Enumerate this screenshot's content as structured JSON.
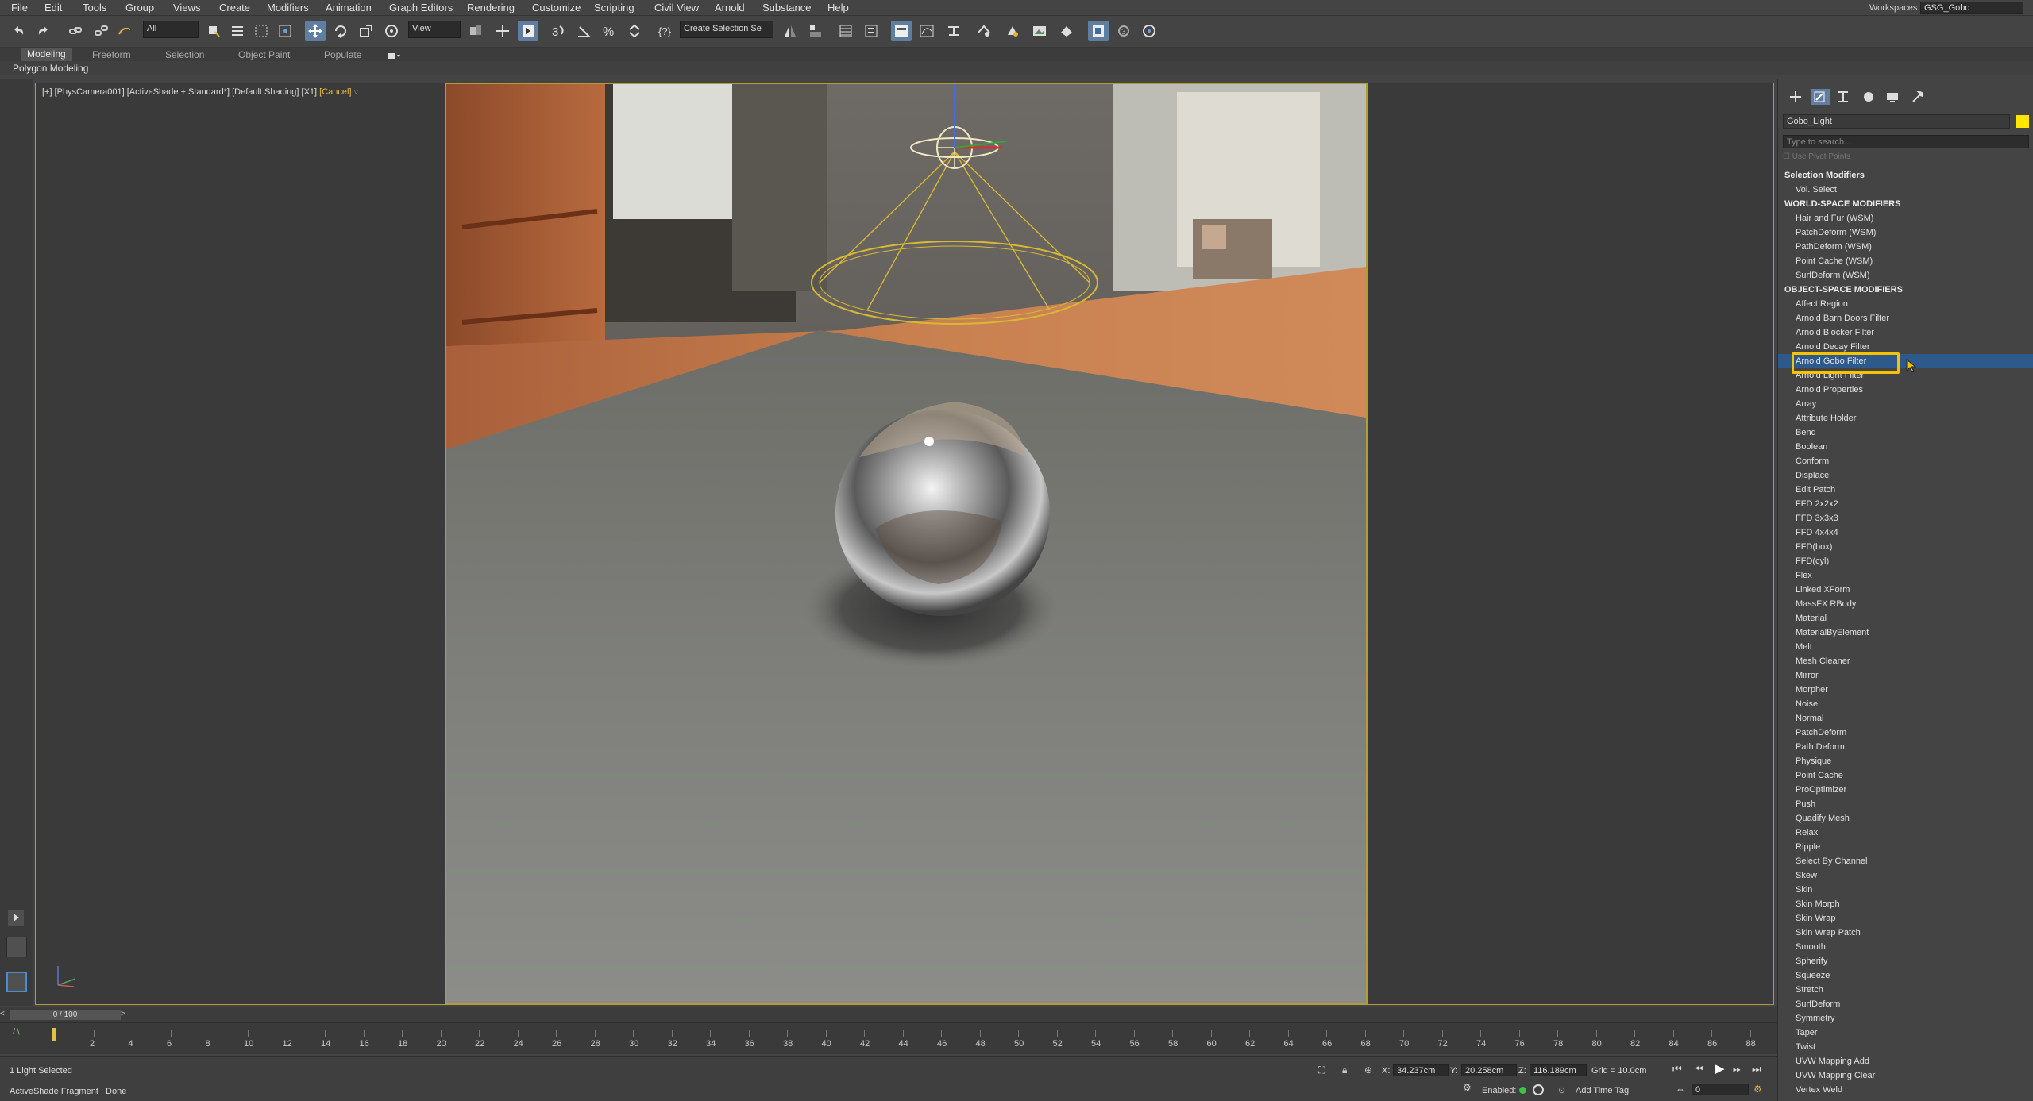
{
  "menu": [
    "File",
    "Edit",
    "Tools",
    "Group",
    "Views",
    "Create",
    "Modifiers",
    "Animation",
    "Graph Editors",
    "Rendering",
    "Customize",
    "Scripting",
    "Civil View",
    "Arnold",
    "Substance",
    "Help"
  ],
  "workspace": {
    "label": "Workspaces:",
    "value": "GSG_Gobo"
  },
  "toolbar": {
    "filter_value": "All",
    "ref_coord_value": "View",
    "selection_set_placeholder": "Create Selection Se"
  },
  "ribbon": {
    "tabs": [
      "Modeling",
      "Freeform",
      "Selection",
      "Object Paint",
      "Populate"
    ],
    "active_tab": "Modeling",
    "sub_label": "Polygon Modeling"
  },
  "viewport": {
    "label_main": "[+] [PhysCamera001] [ActiveShade + Standard*] [Default Shading] [X1]",
    "label_cancel": "[Cancel]"
  },
  "command_panel": {
    "object_name": "Gobo_Light",
    "object_color": "#ffe600",
    "search_placeholder": "Type to search...",
    "use_pivot_points": "Use Pivot Points",
    "modifier_list": [
      {
        "type": "header",
        "label": "Selection Modifiers"
      },
      {
        "type": "item",
        "label": "Vol. Select"
      },
      {
        "type": "header",
        "label": "WORLD-SPACE MODIFIERS"
      },
      {
        "type": "item",
        "label": "Hair and Fur (WSM)"
      },
      {
        "type": "item",
        "label": "PatchDeform (WSM)"
      },
      {
        "type": "item",
        "label": "PathDeform (WSM)"
      },
      {
        "type": "item",
        "label": "Point Cache (WSM)"
      },
      {
        "type": "item",
        "label": "SurfDeform (WSM)"
      },
      {
        "type": "header",
        "label": "OBJECT-SPACE MODIFIERS"
      },
      {
        "type": "item",
        "label": "Affect Region"
      },
      {
        "type": "item",
        "label": "Arnold Barn Doors Filter"
      },
      {
        "type": "item",
        "label": "Arnold Blocker Filter"
      },
      {
        "type": "item",
        "label": "Arnold Decay Filter"
      },
      {
        "type": "item",
        "label": "Arnold Gobo Filter",
        "selected": true
      },
      {
        "type": "item",
        "label": "Arnold Light Filter"
      },
      {
        "type": "item",
        "label": "Arnold Properties"
      },
      {
        "type": "item",
        "label": "Array"
      },
      {
        "type": "item",
        "label": "Attribute Holder"
      },
      {
        "type": "item",
        "label": "Bend"
      },
      {
        "type": "item",
        "label": "Boolean"
      },
      {
        "type": "item",
        "label": "Conform"
      },
      {
        "type": "item",
        "label": "Displace"
      },
      {
        "type": "item",
        "label": "Edit Patch"
      },
      {
        "type": "item",
        "label": "FFD 2x2x2"
      },
      {
        "type": "item",
        "label": "FFD 3x3x3"
      },
      {
        "type": "item",
        "label": "FFD 4x4x4"
      },
      {
        "type": "item",
        "label": "FFD(box)"
      },
      {
        "type": "item",
        "label": "FFD(cyl)"
      },
      {
        "type": "item",
        "label": "Flex"
      },
      {
        "type": "item",
        "label": "Linked XForm"
      },
      {
        "type": "item",
        "label": "MassFX RBody"
      },
      {
        "type": "item",
        "label": "Material"
      },
      {
        "type": "item",
        "label": "MaterialByElement"
      },
      {
        "type": "item",
        "label": "Melt"
      },
      {
        "type": "item",
        "label": "Mesh Cleaner"
      },
      {
        "type": "item",
        "label": "Mirror"
      },
      {
        "type": "item",
        "label": "Morpher"
      },
      {
        "type": "item",
        "label": "Noise"
      },
      {
        "type": "item",
        "label": "Normal"
      },
      {
        "type": "item",
        "label": "PatchDeform"
      },
      {
        "type": "item",
        "label": "Path Deform"
      },
      {
        "type": "item",
        "label": "Physique"
      },
      {
        "type": "item",
        "label": "Point Cache"
      },
      {
        "type": "item",
        "label": "ProOptimizer"
      },
      {
        "type": "item",
        "label": "Push"
      },
      {
        "type": "item",
        "label": "Quadify Mesh"
      },
      {
        "type": "item",
        "label": "Relax"
      },
      {
        "type": "item",
        "label": "Ripple"
      },
      {
        "type": "item",
        "label": "Select By Channel"
      },
      {
        "type": "item",
        "label": "Skew"
      },
      {
        "type": "item",
        "label": "Skin"
      },
      {
        "type": "item",
        "label": "Skin Morph"
      },
      {
        "type": "item",
        "label": "Skin Wrap"
      },
      {
        "type": "item",
        "label": "Skin Wrap Patch"
      },
      {
        "type": "item",
        "label": "Smooth"
      },
      {
        "type": "item",
        "label": "Spherify"
      },
      {
        "type": "item",
        "label": "Squeeze"
      },
      {
        "type": "item",
        "label": "Stretch"
      },
      {
        "type": "item",
        "label": "SurfDeform"
      },
      {
        "type": "item",
        "label": "Symmetry"
      },
      {
        "type": "item",
        "label": "Taper"
      },
      {
        "type": "item",
        "label": "Twist"
      },
      {
        "type": "item",
        "label": "UVW Mapping Add"
      },
      {
        "type": "item",
        "label": "UVW Mapping Clear"
      },
      {
        "type": "item",
        "label": "Vertex Weld"
      }
    ]
  },
  "timeline": {
    "frame_display": "0 / 100",
    "ticks": [
      "2",
      "4",
      "6",
      "8",
      "10",
      "12",
      "14",
      "16",
      "18",
      "20",
      "22",
      "24",
      "26",
      "28",
      "30",
      "32",
      "34",
      "36",
      "38",
      "40",
      "42",
      "44",
      "46",
      "48",
      "50",
      "52",
      "54",
      "56",
      "58",
      "60",
      "62",
      "64",
      "66",
      "68",
      "70",
      "72",
      "74",
      "76",
      "78",
      "80",
      "82",
      "84",
      "86",
      "88"
    ]
  },
  "status": {
    "selection": "1 Light Selected",
    "prompt": "ActiveShade Fragment : Done",
    "x_label": "X:",
    "x_value": "34.237cm",
    "y_label": "Y:",
    "y_value": "20.258cm",
    "z_label": "Z:",
    "z_value": "116.189cm",
    "grid": "Grid = 10.0cm",
    "enabled_label": "Enabled:",
    "add_time_tag": "Add Time Tag",
    "frame_value": "0"
  }
}
